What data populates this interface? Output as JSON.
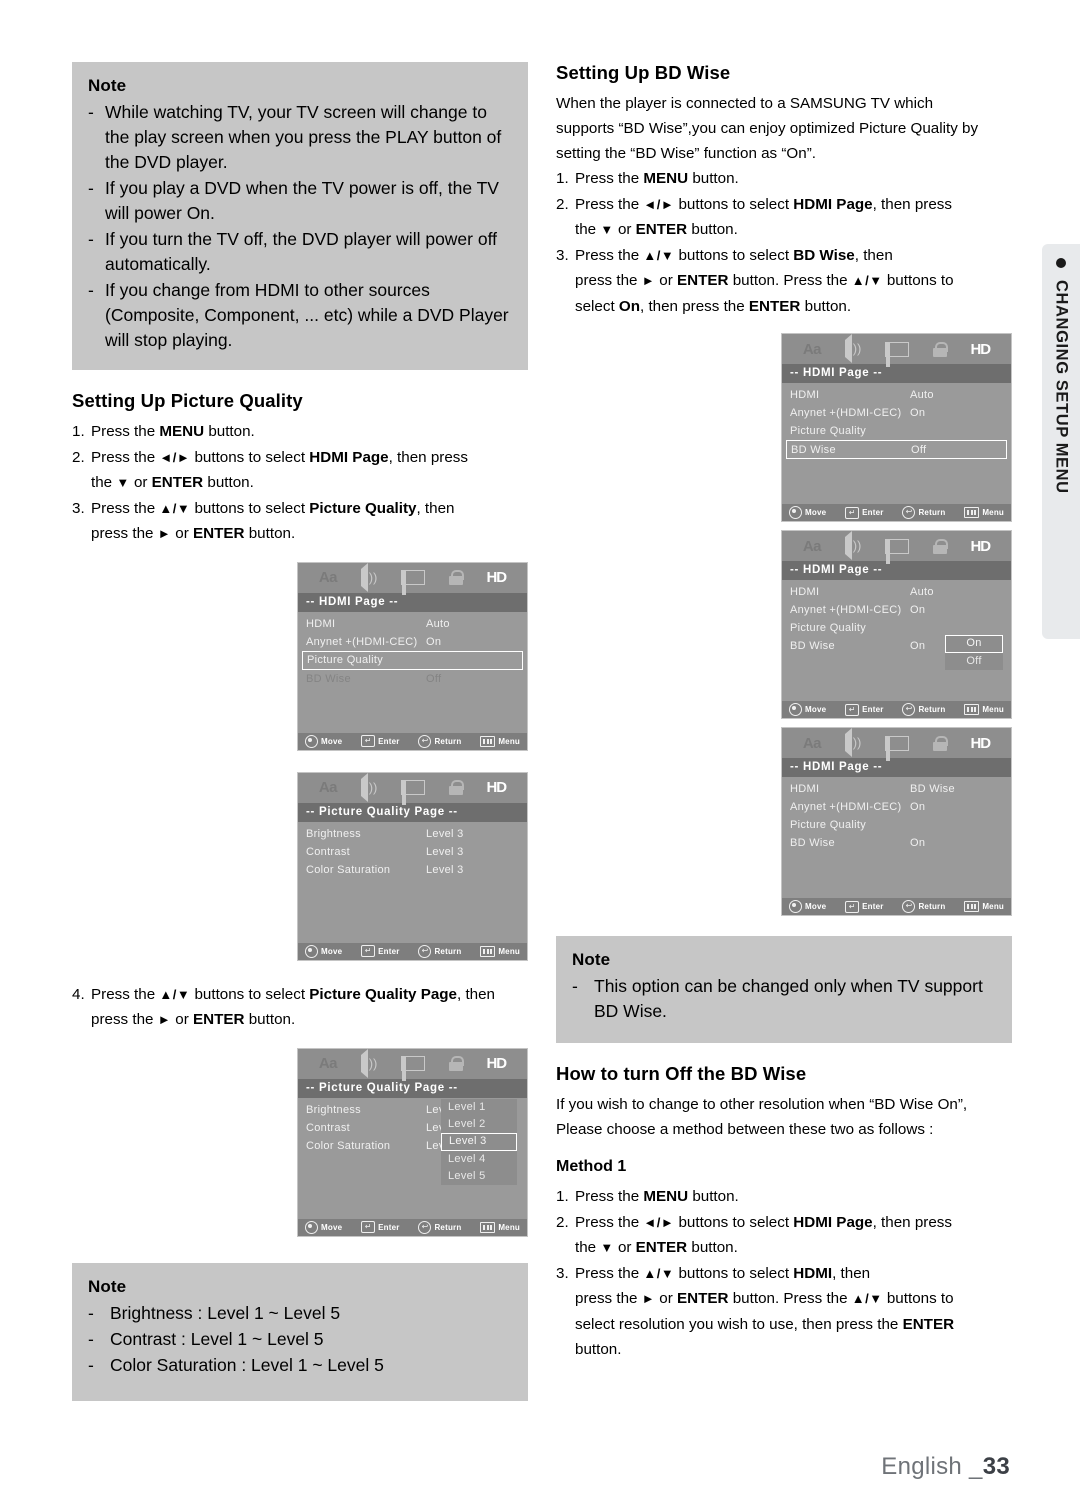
{
  "page": {
    "footer_lang": "English _",
    "footer_number": "33",
    "side_tab_label": "CHANGING SETUP MENU"
  },
  "left_column": {
    "top_note": {
      "title": "Note",
      "lines": [
        "While watching TV, your TV screen will change to the play screen when you press the PLAY button of the DVD player.",
        "If you play a DVD when the TV power is off, the TV will power On.",
        "If you turn the TV off, the DVD player will power off automatically.",
        "If you change from HDMI to other sources (Composite, Component, ... etc) while a DVD Player will stop  playing."
      ]
    },
    "picture_quality_heading": "Setting Up Picture Quality",
    "steps": {
      "s1_num": "1.",
      "s1_a": "Press the ",
      "s1_b": "MENU",
      "s1_c": " button.",
      "s2_num": "2.",
      "s2_a": "Press the ",
      "s2_arrows": "◄/►",
      "s2_b": " buttons to select ",
      "s2_c": "HDMI Page",
      "s2_d": ", then press",
      "s2_e": "the ",
      "s2_f": "▼",
      "s2_g": " or ",
      "s2_h": "ENTER",
      "s2_i": " button.",
      "s3_num": "3.",
      "s3_a": "Press the ",
      "s3_arrows": "▲/▼",
      "s3_b": " buttons to select ",
      "s3_c": "Picture Quality",
      "s3_d": ", then",
      "s3_e": "press the ",
      "s3_f": "►",
      "s3_g": " or ",
      "s3_h": "ENTER",
      "s3_i": " button.",
      "s4_num": "4.",
      "s4_a": "Press the ",
      "s4_arrows": "▲/▼",
      "s4_b": " buttons to select ",
      "s4_c": "Picture Quality Page",
      "s4_d": ", then",
      "s4_e": "press the ",
      "s4_f": "►",
      "s4_g": " or ",
      "s4_h": "ENTER",
      "s4_i": " button."
    },
    "bottom_note": {
      "title": "Note",
      "lines": [
        "Brightness : Level 1 ~ Level 5",
        "Contrast : Level  1 ~ Level  5",
        "Color Saturation : Level  1 ~ Level  5"
      ]
    }
  },
  "right_column": {
    "bd_wise_heading": "Setting Up BD Wise",
    "bd_wise_intro": [
      "When the player is connected to a SAMSUNG TV which",
      "supports “BD Wise”,you can enjoy optimized Picture Quality by",
      "setting the “BD Wise” function as “On”."
    ],
    "steps": {
      "s1_num": "1.",
      "s1_a": "Press the ",
      "s1_b": "MENU",
      "s1_c": " button.",
      "s2_num": "2.",
      "s2_a": "Press the ",
      "s2_arrows": "◄/►",
      "s2_b": " buttons to select ",
      "s2_c": "HDMI Page",
      "s2_d": ", then press",
      "s2_e": "the ",
      "s2_f": "▼",
      "s2_g": " or ",
      "s2_h": "ENTER",
      "s2_i": " button.",
      "s3_num": "3.",
      "s3_a": "Press the ",
      "s3_arrows": "▲/▼",
      "s3_b": " buttons to select ",
      "s3_c": "BD Wise",
      "s3_d": ", then",
      "s3_e": "press the ",
      "s3_f": "►",
      "s3_g": " or ",
      "s3_h": "ENTER",
      "s3_i": " button. Press the ",
      "s3_arrows2": "▲/▼",
      "s3_j": " buttons to",
      "s3_k": "select ",
      "s3_l": "On",
      "s3_m": ", then press the ",
      "s3_n": "ENTER",
      "s3_o": " button."
    },
    "note": {
      "title": "Note",
      "lines": [
        "This option can be changed only when TV support BD Wise."
      ]
    },
    "turn_off_heading": "How to turn Off the BD Wise",
    "turn_off_intro": [
      "If you wish to change to other resolution when “BD Wise On”,",
      "Please choose a method between these two as follows :"
    ],
    "method_title": "Method 1",
    "method_steps": {
      "s1_num": "1.",
      "s1_a": "Press the ",
      "s1_b": "MENU",
      "s1_c": " button.",
      "s2_num": "2.",
      "s2_a": "Press the ",
      "s2_arrows": "◄/►",
      "s2_b": " buttons to select ",
      "s2_c": "HDMI Page",
      "s2_d": ", then press",
      "s2_e": "the ",
      "s2_f": "▼",
      "s2_g": " or ",
      "s2_h": "ENTER",
      "s2_i": " button.",
      "s3_num": "3.",
      "s3_a": "Press the ",
      "s3_arrows": "▲/▼",
      "s3_b": " buttons to select ",
      "s3_c": "HDMI",
      "s3_d": ", then",
      "s3_e": "press the ",
      "s3_f": "►",
      "s3_g": " or ",
      "s3_h": "ENTER",
      "s3_i": " button. Press the ",
      "s3_arrows2": "▲/▼",
      "s3_j": " buttons to",
      "s3_k": "select resolution you wish to use, then press the ",
      "s3_l": "ENTER",
      "s3_m": "button."
    }
  },
  "osd_common": {
    "icons": {
      "language": "Aa",
      "hd": "HD"
    },
    "footer": {
      "move": "Move",
      "enter": "Enter",
      "return": "Return",
      "menu": "Menu",
      "enter_glyph": "↵",
      "return_glyph": "↩"
    }
  },
  "osd_screens": [
    {
      "id": "hdmi-page-picture-quality-selected",
      "page_title": "-- HDMI Page --",
      "rows": [
        {
          "label": "HDMI",
          "value": "Auto",
          "state": "normal"
        },
        {
          "label": "Anynet +(HDMI-CEC)",
          "value": "On",
          "state": "normal"
        },
        {
          "label": "Picture Quality",
          "value": "",
          "state": "selected"
        },
        {
          "label": "BD Wise",
          "value": "Off",
          "state": "dim"
        }
      ]
    },
    {
      "id": "picture-quality-page",
      "page_title": "-- Picture Quality Page --",
      "rows": [
        {
          "label": "Brightness",
          "value": "Level 3",
          "state": "normal"
        },
        {
          "label": "Contrast",
          "value": "Level 3",
          "state": "normal"
        },
        {
          "label": "Color Saturation",
          "value": "Level 3",
          "state": "normal"
        }
      ]
    },
    {
      "id": "picture-quality-page-level-dropdown",
      "page_title": "-- Picture Quality Page --",
      "rows": [
        {
          "label": "Brightness",
          "value": "Level 3",
          "state": "normal"
        },
        {
          "label": "Contrast",
          "value": "Level 3",
          "state": "normal"
        },
        {
          "label": "Color Saturation",
          "value": "Level 3",
          "state": "normal"
        }
      ],
      "dropdown": {
        "options": [
          "Level 1",
          "Level 2",
          "Level 3",
          "Level 4",
          "Level 5"
        ],
        "selected": "Level 3"
      }
    },
    {
      "id": "hdmi-page-bd-wise-selected",
      "page_title": "-- HDMI Page --",
      "rows": [
        {
          "label": "HDMI",
          "value": "Auto",
          "state": "normal"
        },
        {
          "label": "Anynet +(HDMI-CEC)",
          "value": "On",
          "state": "normal"
        },
        {
          "label": "Picture Quality",
          "value": "",
          "state": "normal"
        },
        {
          "label": "BD Wise",
          "value": "Off",
          "state": "selected"
        }
      ]
    },
    {
      "id": "hdmi-page-bd-wise-dropdown",
      "page_title": "-- HDMI Page --",
      "rows": [
        {
          "label": "HDMI",
          "value": "Auto",
          "state": "normal"
        },
        {
          "label": "Anynet +(HDMI-CEC)",
          "value": "On",
          "state": "normal"
        },
        {
          "label": "Picture Quality",
          "value": "",
          "state": "normal"
        },
        {
          "label": "BD Wise",
          "value": "On",
          "state": "normal"
        }
      ],
      "dropdown": {
        "options": [
          "On",
          "Off"
        ],
        "selected": "On"
      }
    },
    {
      "id": "hdmi-page-bd-wise-on",
      "page_title": "-- HDMI Page --",
      "rows": [
        {
          "label": "HDMI",
          "value": "BD Wise",
          "state": "normal"
        },
        {
          "label": "Anynet +(HDMI-CEC)",
          "value": "On",
          "state": "normal"
        },
        {
          "label": "Picture Quality",
          "value": "",
          "state": "normal"
        },
        {
          "label": "BD Wise",
          "value": "On",
          "state": "normal"
        }
      ]
    }
  ]
}
